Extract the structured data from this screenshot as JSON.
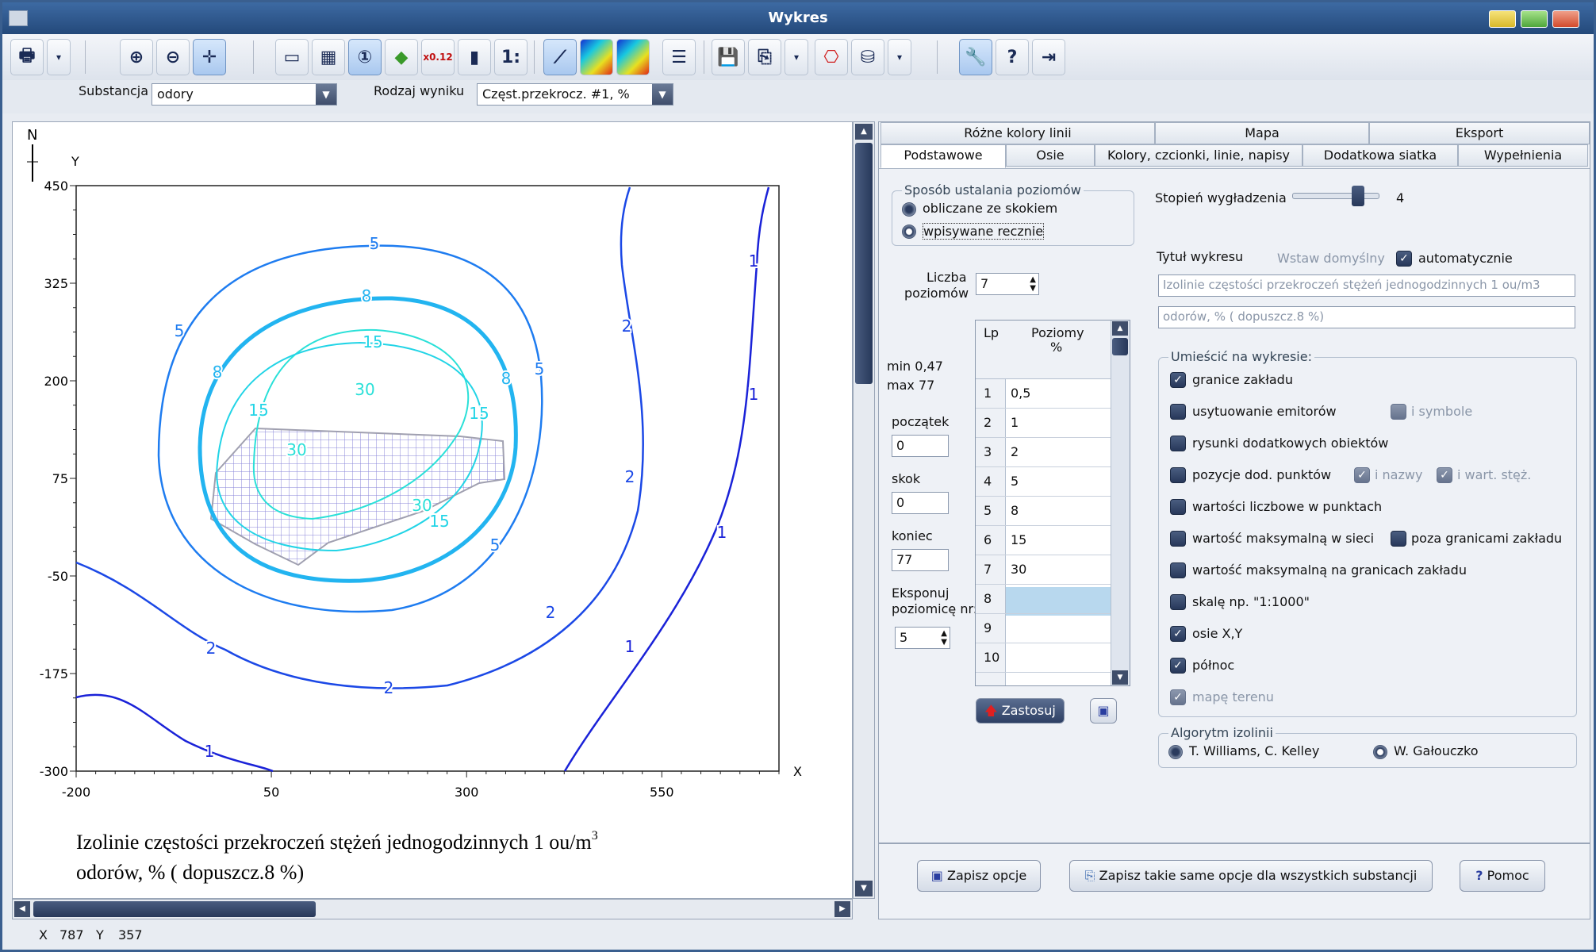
{
  "window": {
    "title": "Wykres"
  },
  "row2": {
    "substancja_label": "Substancja",
    "substancja_value": "odory",
    "rodzaj_label": "Rodzaj wyniku",
    "rodzaj_value": "Częst.przekrocz. #1, %"
  },
  "toolbar": {
    "stats_label": "1:",
    "x012": "0.12"
  },
  "plot": {
    "north": "N",
    "y_axis": "Y",
    "x_axis": "X",
    "y_ticks": [
      "450",
      "325",
      "200",
      "75",
      "-50",
      "-175",
      "-300"
    ],
    "x_ticks": [
      "-200",
      "50",
      "300",
      "550"
    ],
    "caption_line1": "Izolinie częstości przekroczeń stężeń jednogodzinnych 1 ou/m",
    "caption_sup": "3",
    "caption_line2": "odorów, % ( dopuszcz.8 %)",
    "contour_labels": [
      "5",
      "8",
      "15",
      "30",
      "30",
      "30",
      "15",
      "15",
      "15",
      "8",
      "8",
      "5",
      "5",
      "5",
      "2",
      "2",
      "2",
      "2",
      "2",
      "1",
      "1",
      "1",
      "1",
      "1"
    ]
  },
  "status": {
    "x_label": "X",
    "x_value": "787",
    "y_label": "Y",
    "y_value": "357"
  },
  "tabs": {
    "row1": [
      "Różne kolory linii",
      "Mapa",
      "Eksport"
    ],
    "row2": [
      "Podstawowe",
      "Osie",
      "Kolory, czcionki, linie, napisy",
      "Dodatkowa siatka",
      "Wypełnienia"
    ]
  },
  "levels": {
    "group_title": "Sposób ustalania poziomów",
    "opt1": "obliczane ze skokiem",
    "opt2": "wpisywane recznie",
    "count_label1": "Liczba",
    "count_label2": "poziomów",
    "count_value": "7",
    "min": "min 0,47",
    "max": "max 77",
    "start_label": "początek",
    "start_value": "0",
    "step_label": "skok",
    "step_value": "0",
    "end_label": "koniec",
    "end_value": "77",
    "expose_label1": "Eksponuj",
    "expose_label2": "poziomicę nr:",
    "expose_value": "5",
    "table_hdr_lp": "Lp",
    "table_hdr_poz1": "Poziomy",
    "table_hdr_poz2": "%",
    "rows": [
      [
        "1",
        "0,5"
      ],
      [
        "2",
        "1"
      ],
      [
        "3",
        "2"
      ],
      [
        "4",
        "5"
      ],
      [
        "5",
        "8"
      ],
      [
        "6",
        "15"
      ],
      [
        "7",
        "30"
      ],
      [
        "8",
        ""
      ],
      [
        "9",
        ""
      ],
      [
        "10",
        ""
      ]
    ],
    "apply": "Zastosuj"
  },
  "smooth": {
    "label": "Stopień wygładzenia",
    "value": "4"
  },
  "title_opts": {
    "label": "Tytuł wykresu",
    "default_btn": "Wstaw domyślny",
    "auto": "automatycznie",
    "line1": "Izolinie częstości przekroczeń stężeń jednogodzinnych 1 ou/m3",
    "line2": "odorów, % ( dopuszcz.8 %)"
  },
  "place": {
    "group_title": "Umieścić na wykresie:",
    "items": [
      "granice zakładu",
      "usytuowanie emitorów",
      "rysunki dodatkowych  obiektów",
      "pozycje dod. punktów",
      "wartości liczbowe w punktach",
      "wartość maksymalną w sieci",
      "wartość maksymalną na granicach zakładu",
      "skalę  np. \"1:1000\"",
      "osie X,Y",
      "północ",
      "mapę terenu"
    ],
    "symbole": "i symbole",
    "nazwy": "i nazwy",
    "wart": "i wart. stęż.",
    "poza": "poza granicami zakładu"
  },
  "algo": {
    "group_title": "Algorytm izolinii",
    "opt1": "T. Williams, C. Kelley",
    "opt2": "W. Gałouczko"
  },
  "bottom": {
    "save": "Zapisz opcje",
    "save_all": "Zapisz takie same opcje dla wszystkich substancji",
    "help": "Pomoc"
  },
  "colors": {
    "contour1": "#1a22d8",
    "contour2": "#1b48e6",
    "contour5": "#1e7cf0",
    "contour8": "#22b4f0",
    "contour15": "#22d4e6",
    "contour30": "#2ae0d8"
  }
}
